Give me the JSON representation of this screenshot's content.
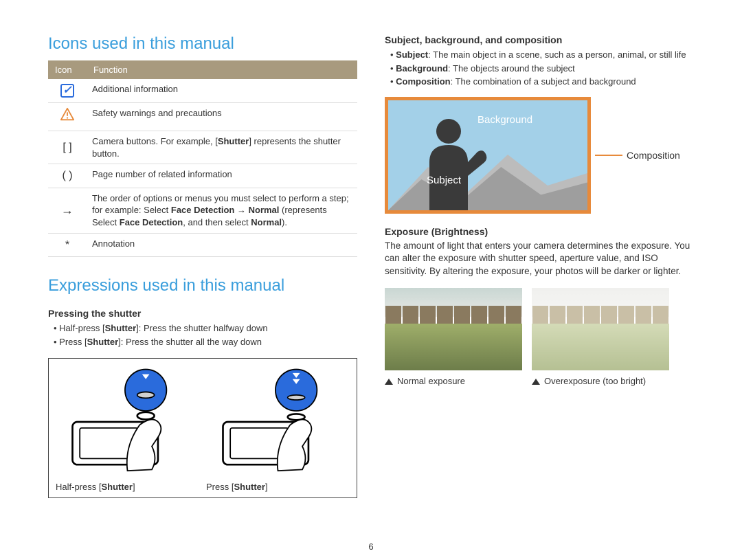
{
  "page_number": "6",
  "left": {
    "section1_title": "Icons used in this manual",
    "table": {
      "header_icon": "Icon",
      "header_function": "Function",
      "rows": [
        {
          "icon_name": "info-icon",
          "glyph": "",
          "function": "Additional information"
        },
        {
          "icon_name": "warning-icon",
          "glyph": "",
          "function": "Safety warnings and precautions"
        },
        {
          "icon_name": "brackets",
          "glyph": "[  ]",
          "function_pre": "Camera buttons. For example, [",
          "function_bold": "Shutter",
          "function_post": "] represents the shutter button."
        },
        {
          "icon_name": "parens",
          "glyph": "(  )",
          "function": "Page number of related information"
        },
        {
          "icon_name": "arrow",
          "glyph": "→",
          "function_pre": "The order of options or menus you must select to perform a step; for example: Select ",
          "bold1": "Face Detection",
          "arrow_txt": " → ",
          "bold2": "Normal",
          "mid": " (represents Select ",
          "bold3": "Face Detection",
          "mid2": ", and then select ",
          "bold4": "Normal",
          "end": ")."
        },
        {
          "icon_name": "asterisk",
          "glyph": "*",
          "function": "Annotation"
        }
      ]
    },
    "section2_title": "Expressions used in this manual",
    "shutter_heading": "Pressing the shutter",
    "shutter_bullets": [
      {
        "pre": "Half-press [",
        "bold": "Shutter",
        "post": "]: Press the shutter halfway down"
      },
      {
        "pre": "Press [",
        "bold": "Shutter",
        "post": "]: Press the shutter all the way down"
      }
    ],
    "shutter_captions": [
      {
        "pre": "Half-press [",
        "bold": "Shutter",
        "post": "]"
      },
      {
        "pre": "Press [",
        "bold": "Shutter",
        "post": "]"
      }
    ]
  },
  "right": {
    "sbc_heading": "Subject, background, and composition",
    "sbc_items": [
      {
        "term": "Subject",
        "desc": ": The main object in a scene, such as a person, animal, or still life"
      },
      {
        "term": "Background",
        "desc": ": The objects around the subject"
      },
      {
        "term": "Composition",
        "desc": ": The combination of a subject and background"
      }
    ],
    "diagram": {
      "background_label": "Background",
      "subject_label": "Subject",
      "composition_label": "Composition"
    },
    "exposure_heading": "Exposure (Brightness)",
    "exposure_para": "The amount of light that enters your camera determines the exposure. You can alter the exposure with shutter speed, aperture value, and ISO sensitivity. By altering the exposure, your photos will be darker or lighter.",
    "photo_captions": [
      "Normal exposure",
      "Overexposure (too bright)"
    ]
  }
}
